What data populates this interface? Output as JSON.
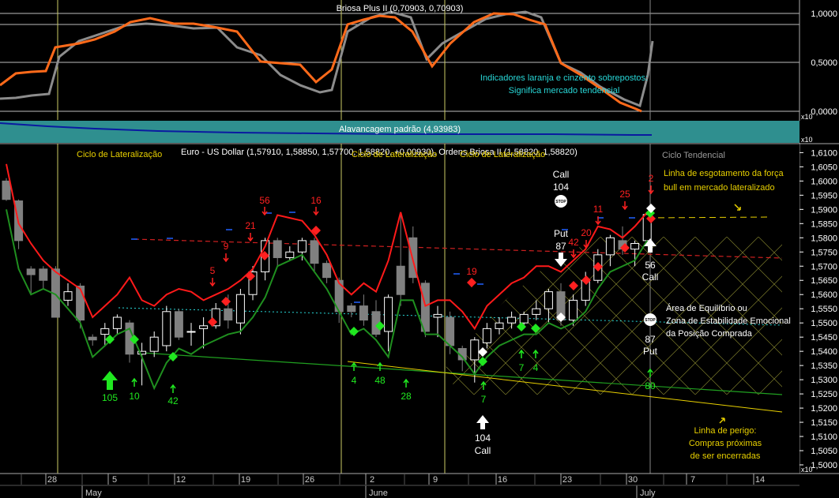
{
  "colors": {
    "background": "#000000",
    "indicator_orange": "#ff6a1a",
    "indicator_gray": "#8c8c8c",
    "leverage_band": "#2f8f8f",
    "leverage_line": "#0a1aa0",
    "candle_up": "#ffffff",
    "candle_down": "#808080",
    "red_line": "#ff1a1a",
    "green_line": "#1f8f1f",
    "cyan": "#28d8d8",
    "yellow_text": "#e8d000",
    "red_text": "#ff2020",
    "green_text": "#20e820",
    "white_text": "#ffffff"
  },
  "top_panel": {
    "title": "Briosa Plus II (0,70903, 0,70903)",
    "annotation_line1": "Indicadores laranja e cinzento sobrepostos:",
    "annotation_line2": "Significa mercado tendencial",
    "ticks": [
      "1,0000",
      "0,5000",
      "0,0000"
    ],
    "scale_tag": "x10"
  },
  "leverage_panel": {
    "title": "Alavancagem padrão (4,93983)",
    "scale_tag": "x10"
  },
  "main_panel": {
    "title": "Euro - US Dollar (1,57910, 1,58850, 1,57700, 1,58820, +0,00930), Ordens Briosa II (1,58820, 1,58820)",
    "cycle_label_1": "Ciclo de Lateralização",
    "cycle_label_2": "Ciclo de Lateralização",
    "cycle_label_3": "Ciclo de Lateralização",
    "cycle_label_4": "Ciclo Tendencial",
    "scale_tag": "x10",
    "price_ticks": [
      "1,6100",
      "1,6050",
      "1,6000",
      "1,5950",
      "1,5900",
      "1,5850",
      "1,5800",
      "1,5750",
      "1,5700",
      "1,5650",
      "1,5600",
      "1,5550",
      "1,5500",
      "1,5450",
      "1,5400",
      "1,5350",
      "1,5300",
      "1,5250",
      "1,5200",
      "1,5150",
      "1,5100",
      "1,5050",
      "1,5000"
    ],
    "exhaustion_note_1": "Linha de esgotamento da força",
    "exhaustion_note_2": "bull em mercado lateralizado",
    "equilibrium_note_1": "Área de Equilíbrio ou",
    "equilibrium_note_2": "Zona de Estabilidade Emocional",
    "equilibrium_note_3": "da Posição Comprada",
    "danger_note_1": "Linha de perigo:",
    "danger_note_2": "Compras próximas",
    "danger_note_3": "de ser encerradas"
  },
  "date_axis": {
    "day_labels": [
      "28",
      "5",
      "12",
      "19",
      "26",
      "2",
      "9",
      "16",
      "23",
      "30",
      "7",
      "14"
    ],
    "month_labels": [
      "May",
      "June",
      "July"
    ]
  },
  "annotations": {
    "red_numbers": [
      "56",
      "16",
      "21",
      "9",
      "5",
      "19",
      "42",
      "20",
      "11",
      "25",
      "2"
    ],
    "green_numbers": [
      "105",
      "10",
      "42",
      "4",
      "48",
      "28",
      "7",
      "7",
      "4",
      "80"
    ],
    "white_labels": {
      "call_top": "Call",
      "call_top_num": "104",
      "put_left": "Put",
      "put_left_num": "87",
      "right_num": "56",
      "right_call": "Call",
      "right_put_num": "87",
      "right_put": "Put",
      "bottom_num": "104",
      "bottom_call": "Call",
      "stop": "STOP"
    }
  },
  "chart_data": {
    "type": "candlestick",
    "title": "Euro - US Dollar (1,57910, 1,58850, 1,57700, 1,58820, +0,00930), Ordens Briosa II (1,58820, 1,58820)",
    "ylim": [
      1.4975,
      1.6115
    ],
    "candles": [
      {
        "o": 1.6,
        "h": 1.601,
        "l": 1.593,
        "c": 1.5935
      },
      {
        "o": 1.593,
        "h": 1.5935,
        "l": 1.576,
        "c": 1.579
      },
      {
        "o": 1.569,
        "h": 1.57,
        "l": 1.56,
        "c": 1.567
      },
      {
        "o": 1.569,
        "h": 1.57,
        "l": 1.562,
        "c": 1.565
      },
      {
        "o": 1.569,
        "h": 1.57,
        "l": 1.557,
        "c": 1.552
      },
      {
        "o": 1.558,
        "h": 1.564,
        "l": 1.556,
        "c": 1.561
      },
      {
        "o": 1.563,
        "h": 1.564,
        "l": 1.548,
        "c": 1.551
      },
      {
        "o": 1.545,
        "h": 1.546,
        "l": 1.542,
        "c": 1.544
      },
      {
        "o": 1.546,
        "h": 1.55,
        "l": 1.542,
        "c": 1.548
      },
      {
        "o": 1.548,
        "h": 1.553,
        "l": 1.546,
        "c": 1.552
      },
      {
        "o": 1.55,
        "h": 1.551,
        "l": 1.536,
        "c": 1.539
      },
      {
        "o": 1.539,
        "h": 1.543,
        "l": 1.528,
        "c": 1.54
      },
      {
        "o": 1.54,
        "h": 1.547,
        "l": 1.538,
        "c": 1.545
      },
      {
        "o": 1.542,
        "h": 1.556,
        "l": 1.54,
        "c": 1.554
      },
      {
        "o": 1.554,
        "h": 1.555,
        "l": 1.544,
        "c": 1.545
      },
      {
        "o": 1.547,
        "h": 1.55,
        "l": 1.542,
        "c": 1.547
      },
      {
        "o": 1.548,
        "h": 1.552,
        "l": 1.541,
        "c": 1.549
      },
      {
        "o": 1.549,
        "h": 1.557,
        "l": 1.548,
        "c": 1.555
      },
      {
        "o": 1.555,
        "h": 1.56,
        "l": 1.548,
        "c": 1.551
      },
      {
        "o": 1.55,
        "h": 1.562,
        "l": 1.546,
        "c": 1.56
      },
      {
        "o": 1.56,
        "h": 1.57,
        "l": 1.558,
        "c": 1.568
      },
      {
        "o": 1.568,
        "h": 1.58,
        "l": 1.565,
        "c": 1.579
      },
      {
        "o": 1.579,
        "h": 1.58,
        "l": 1.57,
        "c": 1.573
      },
      {
        "o": 1.573,
        "h": 1.577,
        "l": 1.572,
        "c": 1.575
      },
      {
        "o": 1.575,
        "h": 1.58,
        "l": 1.572,
        "c": 1.579
      },
      {
        "o": 1.579,
        "h": 1.58,
        "l": 1.568,
        "c": 1.571
      },
      {
        "o": 1.571,
        "h": 1.572,
        "l": 1.564,
        "c": 1.566
      },
      {
        "o": 1.565,
        "h": 1.566,
        "l": 1.55,
        "c": 1.554
      },
      {
        "o": 1.556,
        "h": 1.557,
        "l": 1.552,
        "c": 1.554
      },
      {
        "o": 1.556,
        "h": 1.56,
        "l": 1.549,
        "c": 1.551
      },
      {
        "o": 1.554,
        "h": 1.558,
        "l": 1.545,
        "c": 1.546
      },
      {
        "o": 1.547,
        "h": 1.56,
        "l": 1.54,
        "c": 1.559
      },
      {
        "o": 1.57,
        "h": 1.588,
        "l": 1.556,
        "c": 1.56
      },
      {
        "o": 1.58,
        "h": 1.584,
        "l": 1.564,
        "c": 1.566
      },
      {
        "o": 1.564,
        "h": 1.565,
        "l": 1.545,
        "c": 1.547
      },
      {
        "o": 1.552,
        "h": 1.556,
        "l": 1.545,
        "c": 1.553
      },
      {
        "o": 1.552,
        "h": 1.554,
        "l": 1.539,
        "c": 1.542
      },
      {
        "o": 1.541,
        "h": 1.542,
        "l": 1.533,
        "c": 1.537
      },
      {
        "o": 1.537,
        "h": 1.545,
        "l": 1.529,
        "c": 1.544
      },
      {
        "o": 1.543,
        "h": 1.55,
        "l": 1.541,
        "c": 1.548
      },
      {
        "o": 1.548,
        "h": 1.552,
        "l": 1.546,
        "c": 1.55
      },
      {
        "o": 1.55,
        "h": 1.554,
        "l": 1.548,
        "c": 1.552
      },
      {
        "o": 1.55,
        "h": 1.554,
        "l": 1.548,
        "c": 1.553
      },
      {
        "o": 1.553,
        "h": 1.558,
        "l": 1.551,
        "c": 1.555
      },
      {
        "o": 1.555,
        "h": 1.562,
        "l": 1.55,
        "c": 1.561
      },
      {
        "o": 1.561,
        "h": 1.564,
        "l": 1.549,
        "c": 1.551
      },
      {
        "o": 1.551,
        "h": 1.56,
        "l": 1.549,
        "c": 1.558
      },
      {
        "o": 1.558,
        "h": 1.568,
        "l": 1.556,
        "c": 1.565
      },
      {
        "o": 1.565,
        "h": 1.576,
        "l": 1.564,
        "c": 1.574
      },
      {
        "o": 1.574,
        "h": 1.581,
        "l": 1.57,
        "c": 1.58
      },
      {
        "o": 1.579,
        "h": 1.584,
        "l": 1.574,
        "c": 1.576
      },
      {
        "o": 1.576,
        "h": 1.579,
        "l": 1.57,
        "c": 1.578
      },
      {
        "o": 1.579,
        "h": 1.5885,
        "l": 1.577,
        "c": 1.5882
      }
    ],
    "series": [
      {
        "values_top_red": [
          1.606,
          1.585,
          1.578,
          1.572,
          1.568,
          1.565,
          1.562,
          1.552,
          1.556,
          1.56,
          1.566,
          1.558,
          1.556,
          1.56,
          1.562,
          1.561,
          1.558,
          1.56,
          1.562,
          1.565,
          1.569,
          1.577,
          1.588,
          1.587,
          1.586,
          1.581,
          1.574,
          1.564,
          1.56,
          1.564,
          1.561,
          1.572,
          1.589,
          1.572,
          1.556,
          1.558,
          1.558,
          1.554,
          1.548,
          1.556,
          1.56,
          1.564,
          1.566,
          1.57,
          1.57,
          1.568,
          1.572,
          1.576,
          1.584,
          1.583,
          1.58,
          1.584,
          1.589
        ]
      },
      {
        "values_bottom_green": [
          1.59,
          1.569,
          1.56,
          1.562,
          1.56,
          1.555,
          1.55,
          1.538,
          1.542,
          1.546,
          1.548,
          1.538,
          1.527,
          1.536,
          1.541,
          1.539,
          1.542,
          1.544,
          1.546,
          1.547,
          1.552,
          1.559,
          1.57,
          1.572,
          1.574,
          1.568,
          1.562,
          1.554,
          1.546,
          1.548,
          1.544,
          1.538,
          1.558,
          1.558,
          1.546,
          1.546,
          1.542,
          1.538,
          1.532,
          1.538,
          1.542,
          1.544,
          1.546,
          1.546,
          1.55,
          1.548,
          1.55,
          1.554,
          1.562,
          1.568,
          1.57,
          1.572,
          1.579
        ]
      }
    ]
  }
}
